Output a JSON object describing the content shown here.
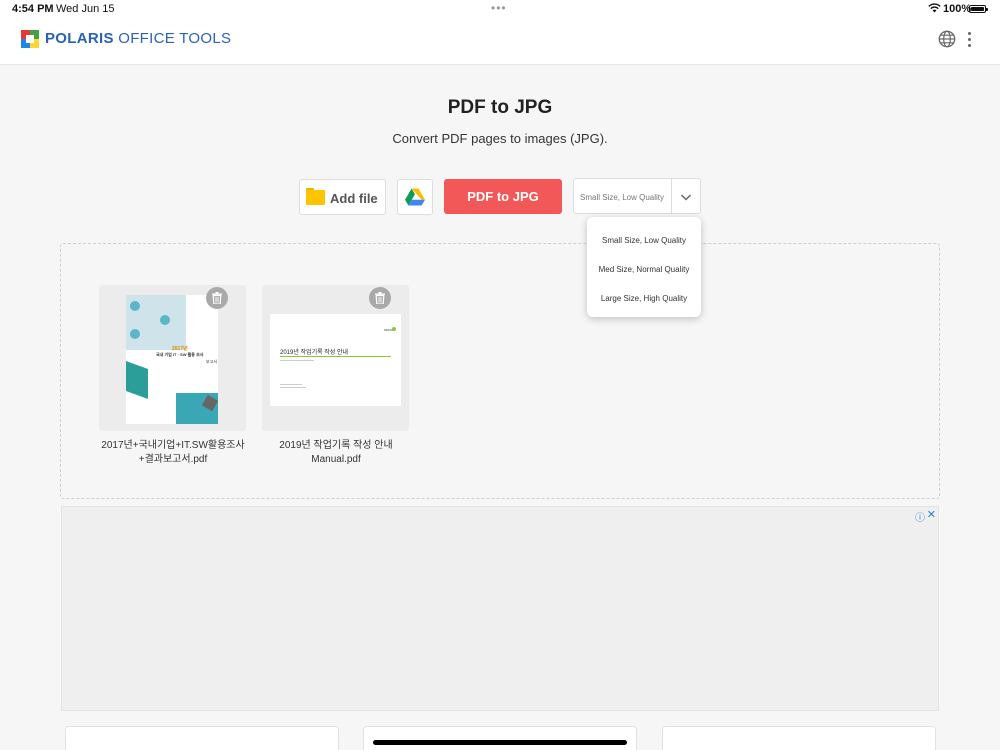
{
  "status_bar": {
    "time": "4:54 PM",
    "date": "Wed Jun 15",
    "battery": "100%",
    "battery_level": 1.0
  },
  "header": {
    "brand_bold": "POLARIS",
    "brand_rest": " OFFICE TOOLS",
    "icons": [
      "globe-icon",
      "more-vertical-icon"
    ]
  },
  "page": {
    "title": "PDF to JPG",
    "subtitle": "Convert PDF pages to images (JPG)."
  },
  "toolbar": {
    "add_file_label": "Add file",
    "convert_label": "PDF to JPG",
    "quality_selected": "Small Size, Low Quality"
  },
  "quality_options": [
    "Small Size, Low Quality",
    "Med Size, Normal Quality",
    "Large Size, High Quality"
  ],
  "files": [
    {
      "name_line1": "2017년+국내기업+IT.SW활용조사",
      "name_line2": "+결과보고서.pdf",
      "thumb_title": "국내 기업 IT · SW 활용 조사",
      "thumb_year": "2017년",
      "thumb_sub": "보고서"
    },
    {
      "name_line1": "2019년 작업기록 작성 안내",
      "name_line2": "Manual.pdf",
      "thumb_title": "2019년 작업기록 작성 안내",
      "thumb_brand": "SECOM"
    }
  ],
  "ad": {
    "info_icon": "info-icon",
    "close_icon": "close-icon"
  },
  "colors": {
    "brand_blue": "#2a62b5",
    "convert_red": "#f25858",
    "folder_yellow": "#ffc400",
    "thumb_green": "#8cc63f"
  }
}
